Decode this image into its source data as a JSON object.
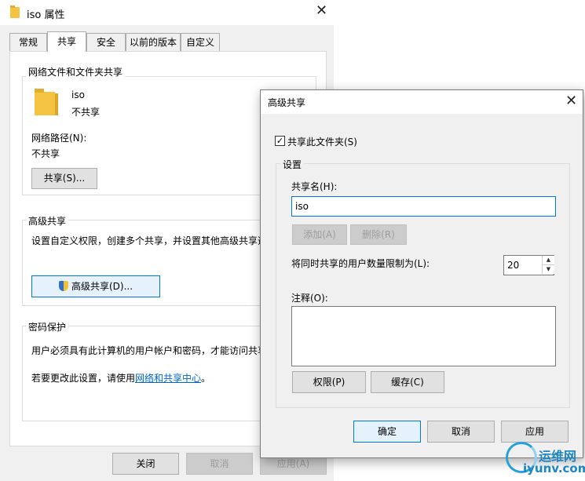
{
  "props_window": {
    "title": "iso 属性",
    "tabs": [
      "常规",
      "共享",
      "安全",
      "以前的版本",
      "自定义"
    ],
    "network_section_title": "网络文件和文件夹共享",
    "folder_name": "iso",
    "share_status": "不共享",
    "network_path_label": "网络路径(N):",
    "network_path_value": "不共享",
    "share_button": "共享(S)...",
    "advanced_section_title": "高级共享",
    "advanced_desc": "设置自定义权限，创建多个共享，并设置其他高级共享选",
    "advanced_button": "高级共享(D)...",
    "password_section_title": "密码保护",
    "password_desc": "用户必须具有此计算机的用户帐户和密码，才能访问共享",
    "change_prefix": "若要更改此设置，请使用",
    "change_link": "网络和共享中心",
    "change_suffix": "。",
    "buttons": {
      "close": "关闭",
      "cancel": "取消",
      "apply": "应用(A)"
    }
  },
  "advanced_dialog": {
    "title": "高级共享",
    "share_checkbox_label": "共享此文件夹(S)",
    "share_checked": true,
    "settings_group": "设置",
    "share_name_label": "共享名(H):",
    "share_name_value": "iso",
    "add_button": "添加(A)",
    "remove_button": "删除(R)",
    "limit_label": "将同时共享的用户数量限制为(L):",
    "limit_value": "20",
    "comment_label": "注释(O):",
    "comment_value": "",
    "permissions_button": "权限(P)",
    "caching_button": "缓存(C)",
    "ok_button": "确定",
    "cancel_button": "取消",
    "apply_button": "应用"
  },
  "watermark": {
    "name": "运维网",
    "url": "iyunv.com"
  }
}
